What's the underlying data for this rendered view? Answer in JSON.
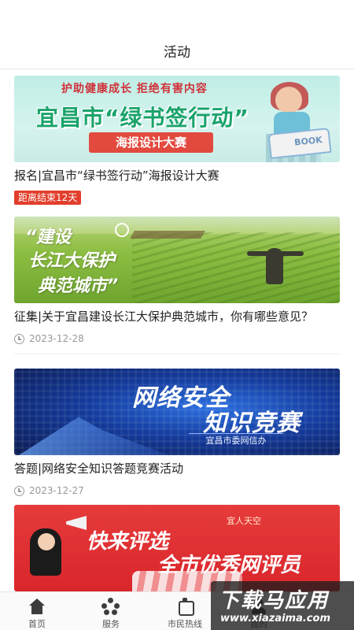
{
  "header": {
    "title": "活动"
  },
  "activities": [
    {
      "title": "报名|宜昌市“绿书签行动”海报设计大赛",
      "tag": "距离结束12天",
      "banner": {
        "slogan": "护助健康成长  拒绝有害内容",
        "headline": "宜昌市“绿书签行动”",
        "ribbon": "海报设计大赛",
        "book_label": "BOOK"
      }
    },
    {
      "title": "征集|关于宜昌建设长江大保护典范城市，你有哪些意见？",
      "date": "2023-12-28",
      "banner": {
        "line1": "“建设",
        "line2": "长江大保护",
        "line3": "典范城市”"
      }
    },
    {
      "title": "答题|网络安全知识答题竞赛活动",
      "date": "2023-12-27",
      "banner": {
        "line1": "网络安全",
        "line2": "知识竞赛",
        "sub": "宜昌市委网信办"
      }
    },
    {
      "banner": {
        "top_tag": "宜人天空",
        "line1": "快来评选",
        "line2": "全市优秀网评员"
      }
    }
  ],
  "tabbar": {
    "items": [
      {
        "label": "首页",
        "icon": "home-icon"
      },
      {
        "label": "服务",
        "icon": "service-icon"
      },
      {
        "label": "市民热线",
        "icon": "hotline-icon"
      },
      {
        "label": "我的",
        "icon": "mine-icon"
      }
    ]
  },
  "watermark": {
    "main": "下载马应用",
    "url": "www.xiazaima.com"
  },
  "colors": {
    "tag_red": "#e23e2b",
    "date_gray": "#999999",
    "divider": "#eeeeee"
  }
}
